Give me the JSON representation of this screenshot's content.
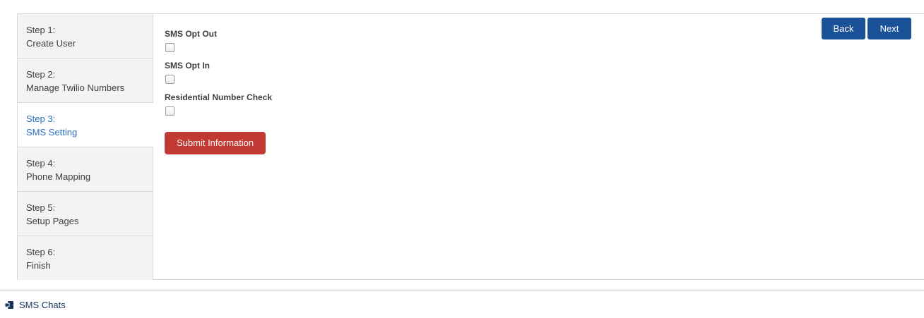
{
  "steps": [
    {
      "number": "Step 1:",
      "name": "Create User",
      "active": false
    },
    {
      "number": "Step 2:",
      "name": "Manage Twilio Numbers",
      "active": false
    },
    {
      "number": "Step 3:",
      "name": "SMS Setting",
      "active": true
    },
    {
      "number": "Step 4:",
      "name": "Phone Mapping",
      "active": false
    },
    {
      "number": "Step 5:",
      "name": "Setup Pages",
      "active": false
    },
    {
      "number": "Step 6:",
      "name": "Finish",
      "active": false
    }
  ],
  "form": {
    "fields": [
      {
        "label": "SMS Opt Out",
        "checked": false
      },
      {
        "label": "SMS Opt In",
        "checked": false
      },
      {
        "label": "Residential Number Check",
        "checked": false
      }
    ],
    "submit_label": "Submit Information"
  },
  "nav": {
    "back_label": "Back",
    "next_label": "Next"
  },
  "footer": {
    "item_label": "SMS Chats",
    "icon": "chat-icon"
  },
  "colors": {
    "active_step": "#2a6ebb",
    "nav_button": "#1b5297",
    "submit_button": "#c23934"
  }
}
